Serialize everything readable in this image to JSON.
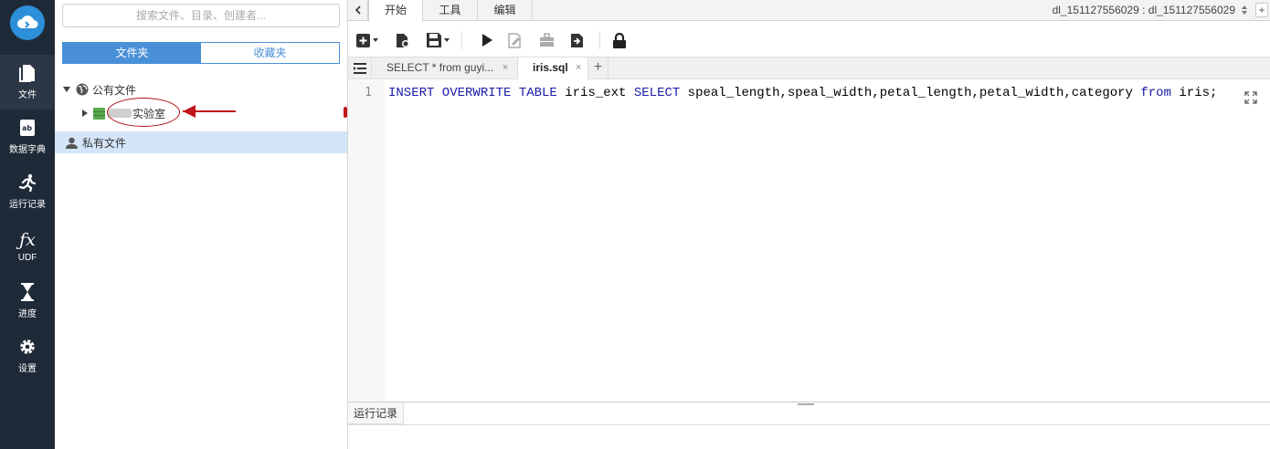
{
  "nav": {
    "items": [
      {
        "label": "文件",
        "icon": "file-icon"
      },
      {
        "label": "数据字典",
        "icon": "data-dictionary-icon"
      },
      {
        "label": "运行记录",
        "icon": "running-man-icon"
      },
      {
        "label": "UDF",
        "icon": "fx-icon",
        "glyph": "ƒx"
      },
      {
        "label": "进度",
        "icon": "hourglass-icon"
      },
      {
        "label": "设置",
        "icon": "gear-icon"
      }
    ]
  },
  "panel": {
    "search_placeholder": "搜索文件、目录、创建者...",
    "seg_folders": "文件夹",
    "seg_favorites": "收藏夹",
    "tree": {
      "public_files": "公有文件",
      "lab": "实验室",
      "private_files": "私有文件"
    }
  },
  "menubar": {
    "tabs": [
      "开始",
      "工具",
      "编辑"
    ],
    "connection": "dl_151127556029 : dl_151127556029",
    "add": "+"
  },
  "editor": {
    "tabs": [
      {
        "label": "SELECT * from guyi...",
        "close": "×"
      },
      {
        "label": "iris.sql",
        "close": "×"
      }
    ],
    "add_tab": "+",
    "line_number": "1",
    "code": {
      "kw1": "INSERT OVERWRITE TABLE",
      "t1": " iris_ext ",
      "kw2": "SELECT",
      "t2": " speal_length,speal_width,petal_length,petal_width,category ",
      "kw3": "from",
      "t3": " iris;"
    }
  },
  "bottom": {
    "tab": "运行记录"
  },
  "colors": {
    "rail": "#1f2a38",
    "accent": "#4a90d9",
    "keyword": "#1a1aa6",
    "annotation": "#c0161a"
  }
}
